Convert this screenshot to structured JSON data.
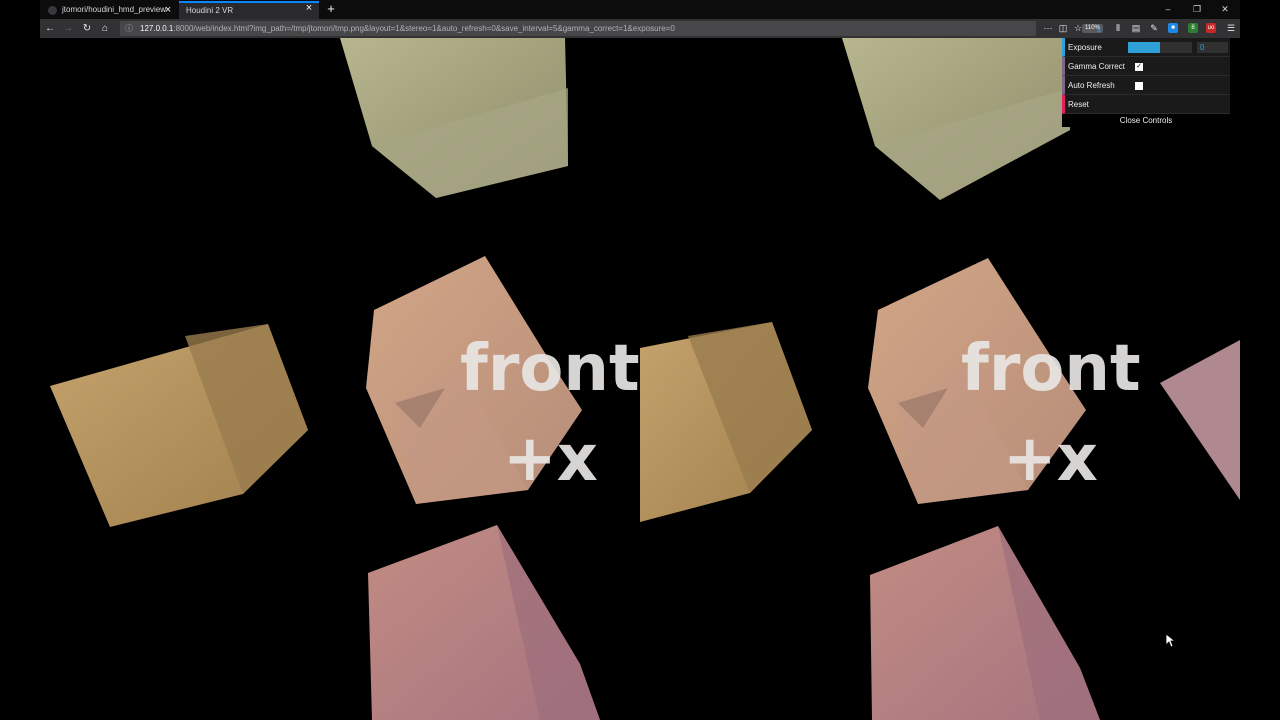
{
  "browser": {
    "tabs": [
      {
        "label": "jtomori/houdini_hmd_preview",
        "active": false
      },
      {
        "label": "Houdini 2 VR",
        "active": true
      }
    ],
    "new_tab": "+",
    "window_controls": {
      "minimize": "–",
      "restore": "❐",
      "close": "✕"
    },
    "nav": {
      "back": "←",
      "forward": "→",
      "reload": "↻",
      "home": "⌂"
    },
    "url": {
      "host": "127.0.0.1",
      "rest": ":8000/web/index.html?img_path=/tmp/jtomori/tmp.png&layout=1&stereo=1&auto_refresh=0&save_interval=5&gamma_correct=1&exposure=0"
    },
    "zoom": "110%",
    "toolbar_icons": [
      "more-icon",
      "pocket-icon",
      "bookmark-star-icon",
      "download-icon",
      "library-icon",
      "sidebar-icon",
      "eyedropper-icon"
    ],
    "extensions": [
      {
        "name": "extension-blue",
        "color": "#1e88e5",
        "glyph": "■"
      },
      {
        "name": "extension-green",
        "color": "#2e7d32",
        "glyph": "8"
      },
      {
        "name": "extension-ublock",
        "color": "#c62828",
        "glyph": "uo"
      }
    ],
    "menu": "☰"
  },
  "scene": {
    "label_front": "front",
    "label_x": "+x",
    "background": "#000000"
  },
  "gui": {
    "exposure": {
      "label": "Exposure",
      "value": "0",
      "slider_fraction": 0.5
    },
    "gamma_correct": {
      "label": "Gamma Correct",
      "checked": true,
      "mark": "✓"
    },
    "auto_refresh": {
      "label": "Auto Refresh",
      "checked": false,
      "mark": ""
    },
    "reset": {
      "label": "Reset"
    },
    "close_controls": "Close Controls",
    "colors": {
      "number": "#2fa1d6",
      "boolean": "#806787",
      "function": "#e61d5f"
    }
  }
}
